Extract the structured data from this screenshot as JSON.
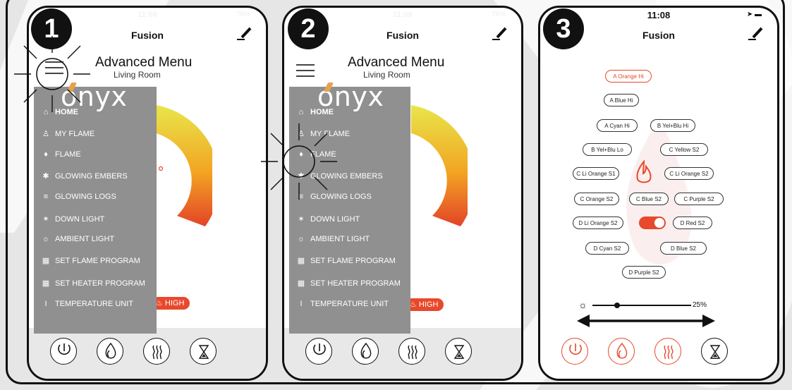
{
  "status": {
    "time": "11:08",
    "battery": "78%"
  },
  "app_title": "Fusion",
  "advanced_menu_label": "Advanced Menu",
  "room_label": "Living Room",
  "logo_text": "onyx",
  "steps": [
    "1",
    "2",
    "3"
  ],
  "drawer_items": [
    {
      "icon": "home-icon",
      "glyph": "⌂",
      "label": "HOME"
    },
    {
      "icon": "person-icon",
      "glyph": "♙",
      "label": "MY FLAME"
    },
    {
      "icon": "flame-icon",
      "glyph": "♦",
      "label": "FLAME"
    },
    {
      "icon": "embers-icon",
      "glyph": "✱",
      "label": "GLOWING EMBERS"
    },
    {
      "icon": "logs-icon",
      "glyph": "≡",
      "label": "GLOWING LOGS"
    },
    {
      "icon": "down-light-icon",
      "glyph": "✶",
      "label": "DOWN LIGHT"
    },
    {
      "icon": "ambient-light-icon",
      "glyph": "☼",
      "label": "AMBIENT LIGHT"
    },
    {
      "icon": "calendar-icon",
      "glyph": "▦",
      "label": "SET FLAME PROGRAM"
    },
    {
      "icon": "calendar-icon",
      "glyph": "▦",
      "label": "SET HEATER PROGRAM"
    },
    {
      "icon": "thermometer-icon",
      "glyph": "I",
      "label": "TEMPERATURE UNIT"
    }
  ],
  "heat_badge": "HIGH",
  "colors": {
    "accent": "#e8482b",
    "drawer": "#909090",
    "gauge_yellow": "#e8e64a",
    "gauge_red": "#e34327"
  },
  "flame_colors": [
    {
      "label": "A Orange Hi",
      "active": true
    },
    {
      "label": "A Blue Hi"
    },
    {
      "label": "A Cyan Hi"
    },
    {
      "label": "B Yel+Blu Hi"
    },
    {
      "label": "B Yel+Blu Lo"
    },
    {
      "label": "C Yellow S2"
    },
    {
      "label": "C Li Orange S1"
    },
    {
      "label": "C Li Orange S2"
    },
    {
      "label": "C Orange S2"
    },
    {
      "label": "C Blue S2"
    },
    {
      "label": "C Purple S2"
    },
    {
      "label": "D Li Orange S2"
    },
    {
      "label": "D Red S2"
    },
    {
      "label": "D Cyan S2"
    },
    {
      "label": "D Blue S2"
    },
    {
      "label": "D Purple S2"
    }
  ],
  "toggle_on": true,
  "brightness": {
    "value": 0.25,
    "label": "25%"
  },
  "bottom_buttons": [
    "power-icon",
    "flame-icon",
    "heat-icon",
    "timer-icon"
  ]
}
